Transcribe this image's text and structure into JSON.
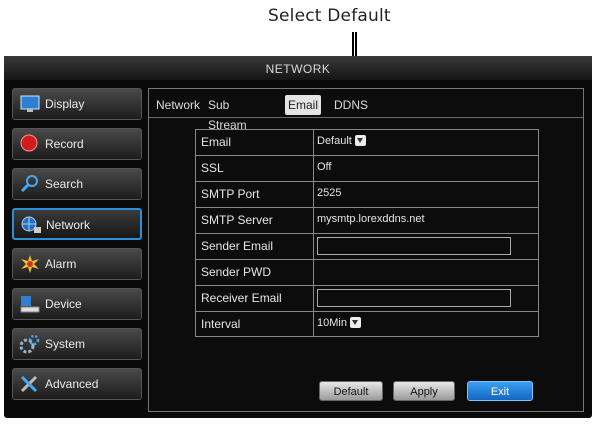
{
  "annotation": {
    "text": "Select Default"
  },
  "window": {
    "title": "NETWORK"
  },
  "sidebar": {
    "items": [
      {
        "label": "Display",
        "icon": "monitor-icon"
      },
      {
        "label": "Record",
        "icon": "record-icon"
      },
      {
        "label": "Search",
        "icon": "search-icon"
      },
      {
        "label": "Network",
        "icon": "network-icon",
        "active": true
      },
      {
        "label": "Alarm",
        "icon": "alarm-icon"
      },
      {
        "label": "Device",
        "icon": "device-icon"
      },
      {
        "label": "System",
        "icon": "system-icon"
      },
      {
        "label": "Advanced",
        "icon": "advanced-icon"
      }
    ]
  },
  "tabs": [
    {
      "label": "Network"
    },
    {
      "label": "Sub Stream"
    },
    {
      "label": "Email",
      "active": true
    },
    {
      "label": "DDNS"
    }
  ],
  "email_settings": {
    "email": {
      "label": "Email",
      "value": "Default"
    },
    "ssl": {
      "label": "SSL",
      "value": "Off"
    },
    "smtp_port": {
      "label": "SMTP Port",
      "value": "2525"
    },
    "smtp_server": {
      "label": "SMTP Server",
      "value": "mysmtp.lorexddns.net"
    },
    "sender_email": {
      "label": "Sender Email",
      "value": ""
    },
    "sender_pwd": {
      "label": "Sender PWD",
      "value": ""
    },
    "receiver_email": {
      "label": "Receiver Email",
      "value": ""
    },
    "interval": {
      "label": "Interval",
      "value": "10Min"
    }
  },
  "buttons": {
    "default": "Default",
    "apply": "Apply",
    "exit": "Exit"
  },
  "colors": {
    "accent": "#2e8fd8",
    "background": "#0a0a0a",
    "text": "#e6e6e6"
  }
}
